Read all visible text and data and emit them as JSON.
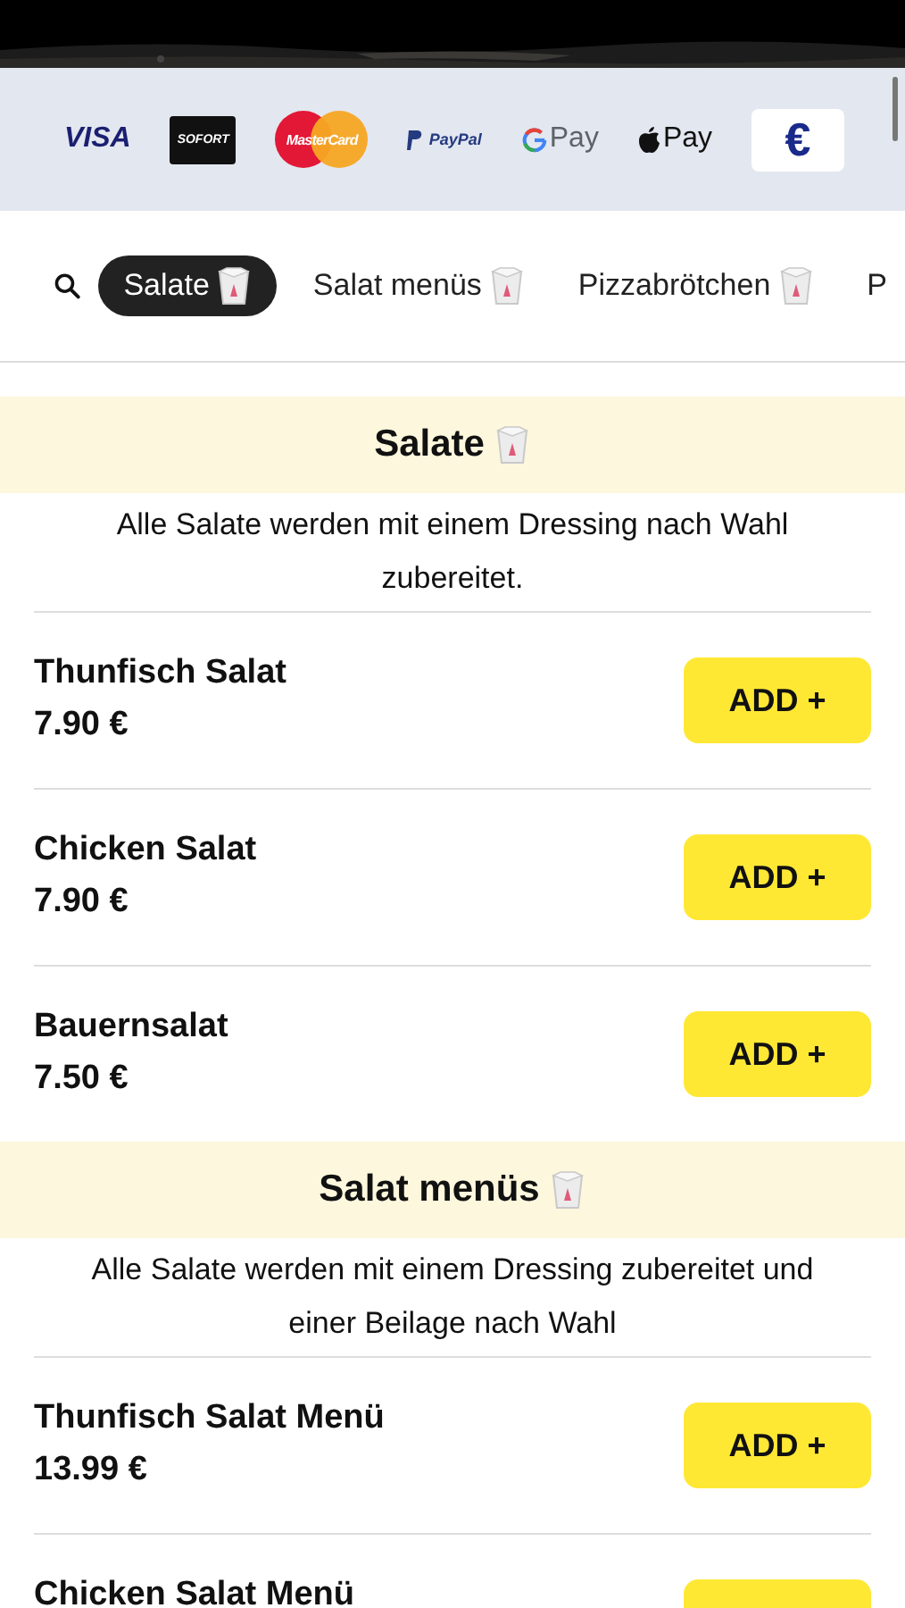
{
  "payment_methods": [
    {
      "kind": "visa",
      "label": "VISA"
    },
    {
      "kind": "sofort",
      "label": "SOFORT"
    },
    {
      "kind": "mastercard",
      "label": "MasterCard"
    },
    {
      "kind": "paypal",
      "label": "PayPal"
    },
    {
      "kind": "gpay",
      "label": "Pay"
    },
    {
      "kind": "applepay",
      "label": "Pay"
    },
    {
      "kind": "currency",
      "label": "€"
    }
  ],
  "categories": [
    {
      "label": "Salate",
      "selected": true,
      "box": true
    },
    {
      "label": "Salat menüs",
      "selected": false,
      "box": true
    },
    {
      "label": "Pizzabrötchen",
      "selected": false,
      "box": true
    },
    {
      "label": "P",
      "selected": false,
      "box": false
    }
  ],
  "sections": [
    {
      "title": "Salate",
      "box": true,
      "description": "Alle Salate werden mit einem Dressing nach Wahl zubereitet.",
      "items": [
        {
          "name": "Thunfisch Salat",
          "price": "7.90 €",
          "button": "ADD +"
        },
        {
          "name": "Chicken Salat",
          "price": "7.90 €",
          "button": "ADD +"
        },
        {
          "name": "Bauernsalat",
          "price": "7.50 €",
          "button": "ADD +"
        }
      ]
    },
    {
      "title": "Salat menüs",
      "box": true,
      "description": "Alle Salate werden mit einem Dressing zubereitet und einer Beilage nach Wahl",
      "items": [
        {
          "name": "Thunfisch Salat Menü",
          "price": "13.99 €",
          "button": "ADD +"
        },
        {
          "name": "Chicken Salat Menü"
        }
      ]
    }
  ]
}
